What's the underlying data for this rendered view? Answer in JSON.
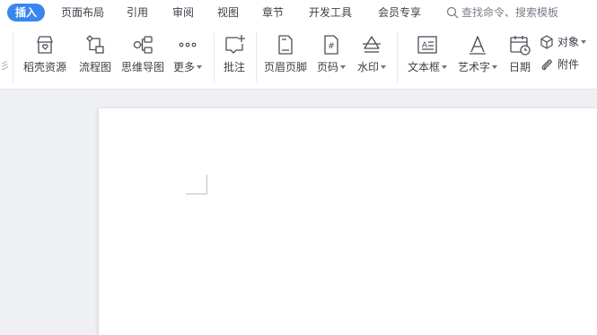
{
  "tabs": [
    {
      "label": "插入",
      "active": true
    },
    {
      "label": "页面布局"
    },
    {
      "label": "引用"
    },
    {
      "label": "审阅"
    },
    {
      "label": "视图"
    },
    {
      "label": "章节"
    },
    {
      "label": "开发工具"
    },
    {
      "label": "会员专享"
    }
  ],
  "search": {
    "placeholder": "查找命令、搜索模板",
    "icon": "search-icon"
  },
  "ribbon": {
    "partial_left": "彡",
    "tools": [
      {
        "label": "稻壳资源",
        "icon": "store-icon"
      },
      {
        "label": "流程图",
        "icon": "flowchart-icon"
      },
      {
        "label": "思维导图",
        "icon": "mindmap-icon"
      },
      {
        "label": "更多",
        "icon": "more-icon",
        "dropdown": true
      },
      {
        "label": "批注",
        "icon": "comment-icon"
      },
      {
        "label": "页眉页脚",
        "icon": "header-footer-icon"
      },
      {
        "label": "页码",
        "icon": "page-number-icon",
        "dropdown": true
      },
      {
        "label": "水印",
        "icon": "watermark-icon",
        "dropdown": true
      },
      {
        "label": "文本框",
        "icon": "textbox-icon",
        "dropdown": true
      },
      {
        "label": "艺术字",
        "icon": "wordart-icon",
        "dropdown": true
      },
      {
        "label": "日期",
        "icon": "calendar-icon"
      }
    ],
    "small_tools": [
      {
        "label": "对象",
        "icon": "object-icon",
        "dropdown": true
      },
      {
        "label": "附件",
        "icon": "attachment-icon"
      }
    ]
  },
  "colors": {
    "accent": "#3a86ef",
    "background": "#eef0f3",
    "ribbon": "#ffffff"
  }
}
